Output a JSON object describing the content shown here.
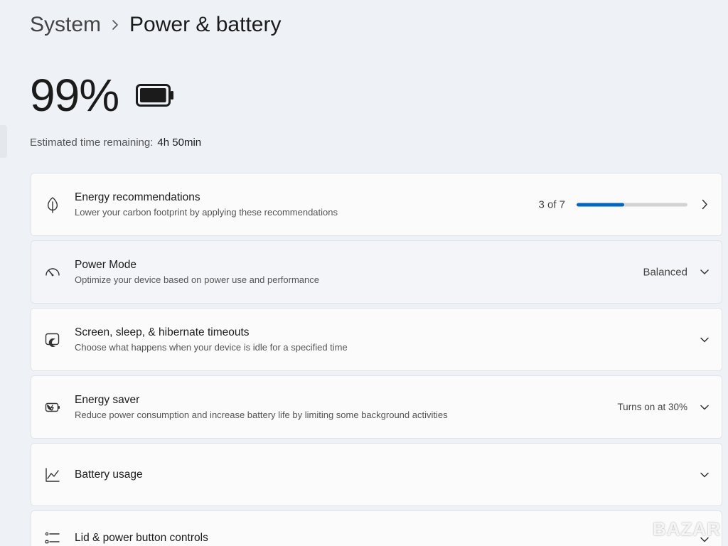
{
  "breadcrumb": {
    "parent": "System",
    "current": "Power & battery"
  },
  "battery": {
    "percent_label": "99%",
    "level_fraction": 0.99,
    "time_remaining_label": "Estimated time remaining:",
    "time_remaining_value": "4h 50min"
  },
  "colors": {
    "accent": "#0067c0",
    "page_bg": "#eef1f6",
    "card_bg": "#fbfbfc"
  },
  "cards": {
    "energy_recommendations": {
      "icon": "leaf-icon",
      "title": "Energy recommendations",
      "description": "Lower your carbon footprint by applying these recommendations",
      "status": "3 of 7",
      "progress_fraction": 0.4286
    },
    "power_mode": {
      "icon": "speedometer-icon",
      "title": "Power Mode",
      "description": "Optimize your device based on power use and performance",
      "value": "Balanced"
    },
    "screen_sleep": {
      "icon": "screen-sleep-icon",
      "title": "Screen, sleep, & hibernate timeouts",
      "description": "Choose what happens when your device is idle for a specified time"
    },
    "energy_saver": {
      "icon": "energy-saver-icon",
      "title": "Energy saver",
      "description": "Reduce power consumption and increase battery life by limiting some background activities",
      "value": "Turns on at 30%"
    },
    "battery_usage": {
      "icon": "chart-icon",
      "title": "Battery usage"
    },
    "lid_power": {
      "icon": "list-icon",
      "title": "Lid & power button controls"
    }
  },
  "watermark": "BAZAR"
}
